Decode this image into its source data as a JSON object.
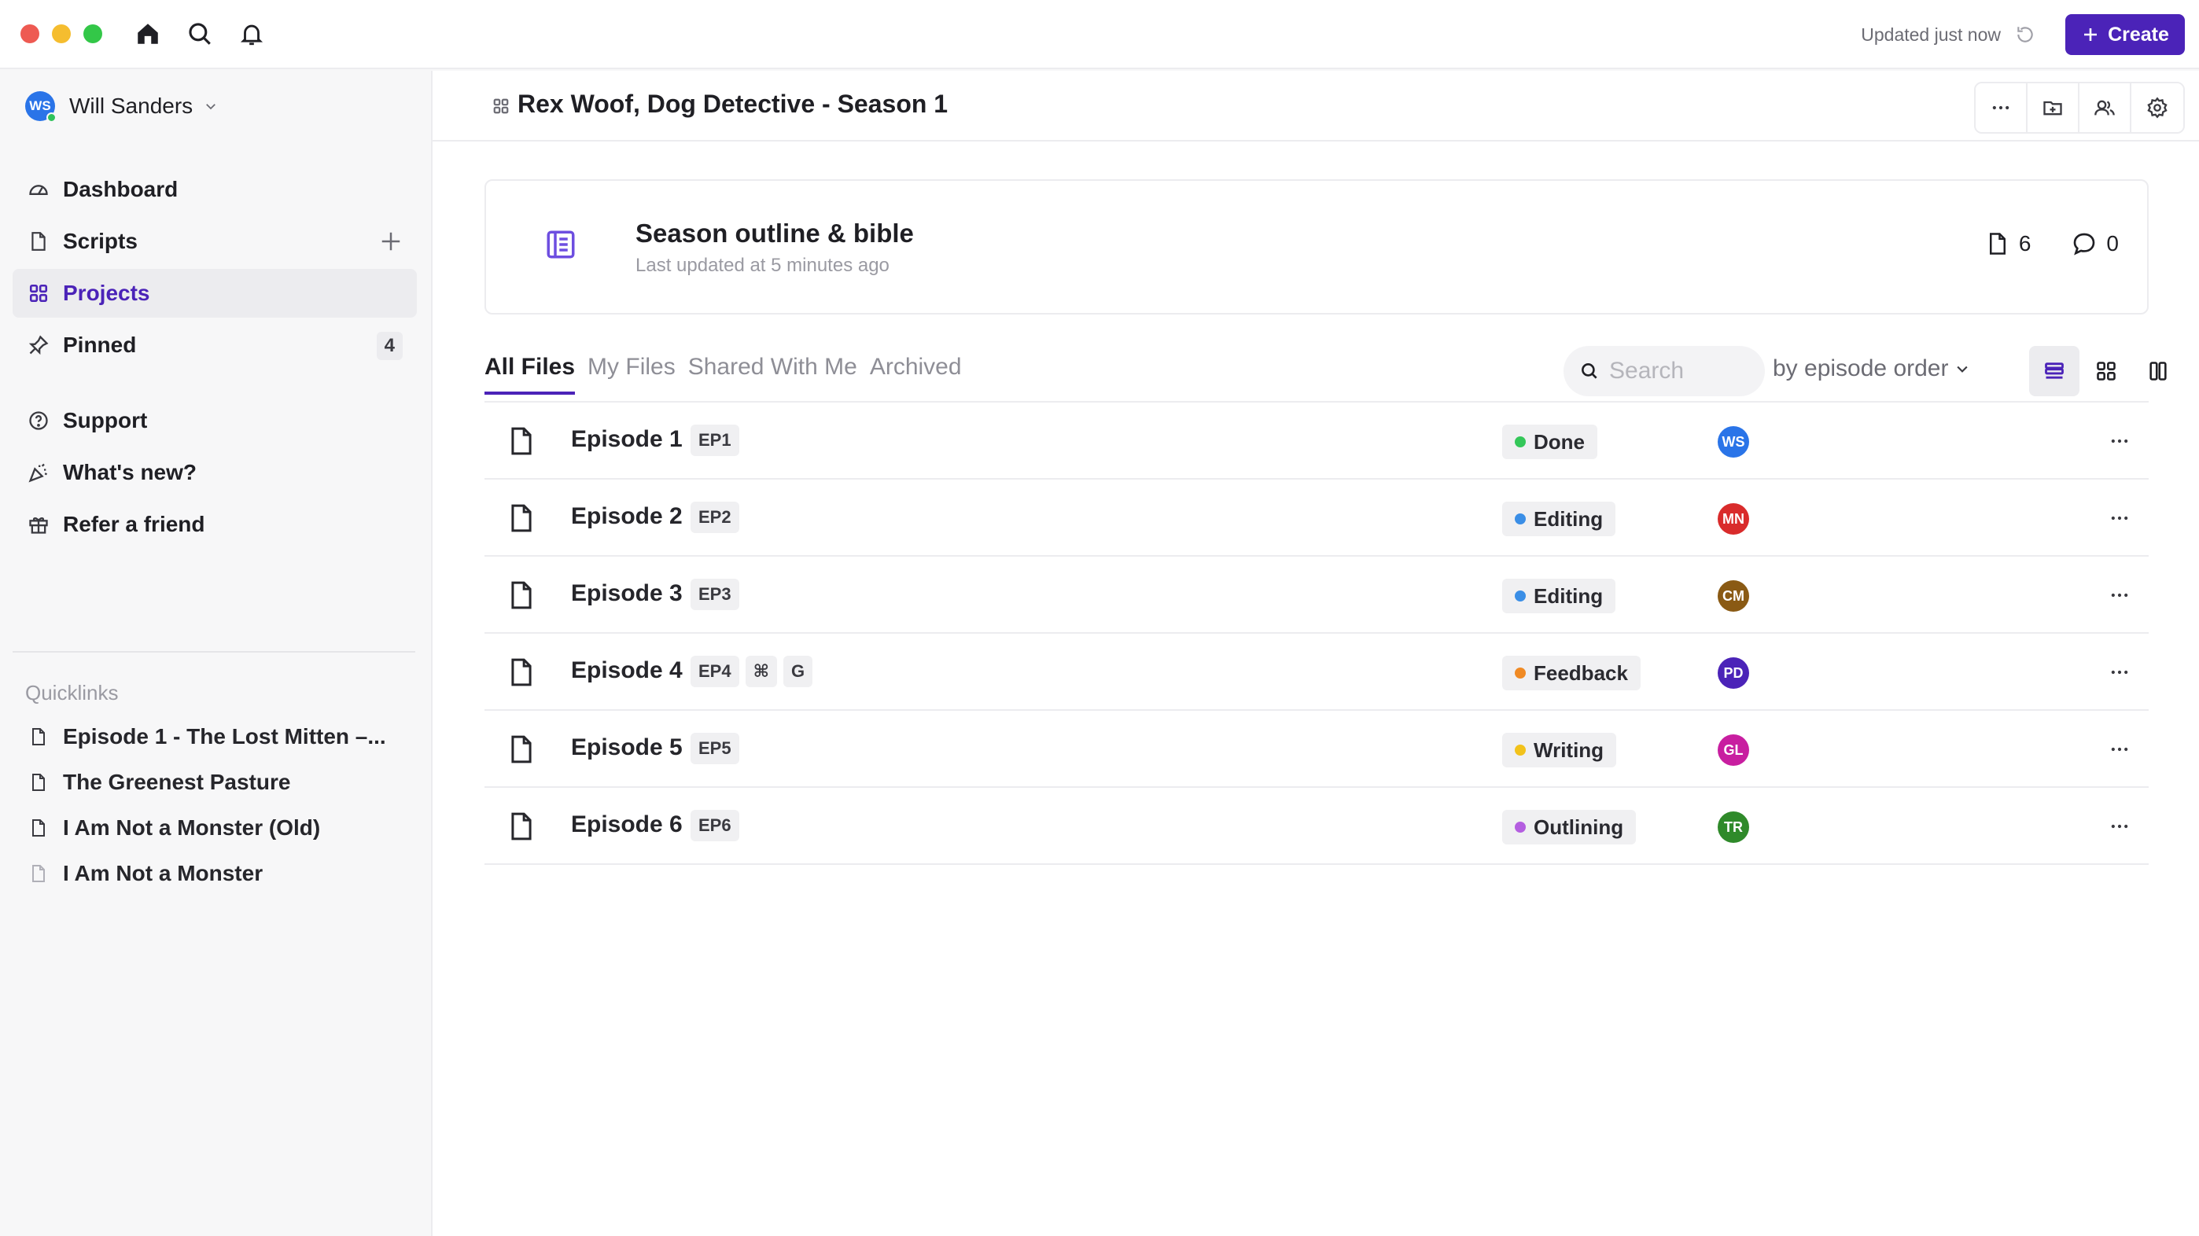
{
  "topbar": {
    "updated_text": "Updated just now",
    "create_label": "Create",
    "accent_color": "#4b23b8"
  },
  "sidebar": {
    "user": {
      "initials": "WS",
      "name": "Will Sanders"
    },
    "nav": [
      {
        "label": "Dashboard",
        "icon": "gauge-icon"
      },
      {
        "label": "Scripts",
        "icon": "document-icon"
      },
      {
        "label": "Projects",
        "icon": "grid-icon",
        "active": true
      },
      {
        "label": "Pinned",
        "icon": "pin-icon",
        "badge": "4"
      },
      {
        "label": "Support",
        "icon": "help-circle-icon"
      },
      {
        "label": "What's new?",
        "icon": "party-popper-icon"
      },
      {
        "label": "Refer a friend",
        "icon": "gift-icon"
      }
    ],
    "quicklinks_title": "Quicklinks",
    "quicklinks": [
      {
        "label": "Episode 1 - The Lost Mitten –..."
      },
      {
        "label": "The Greenest Pasture"
      },
      {
        "label": "I Am Not a Monster (Old)"
      },
      {
        "label": "I Am Not a Monster"
      }
    ]
  },
  "main": {
    "project_title": "Rex Woof, Dog Detective - Season 1",
    "outline": {
      "title": "Season outline & bible",
      "subtitle": "Last updated at 5 minutes ago",
      "doc_count": "6",
      "comment_count": "0"
    },
    "tabs": [
      {
        "label": "All Files",
        "active": true
      },
      {
        "label": "My Files"
      },
      {
        "label": "Shared With Me"
      },
      {
        "label": "Archived"
      }
    ],
    "search_placeholder": "Search",
    "sort_label": "by episode order",
    "files": [
      {
        "name": "Episode 1",
        "tags": [
          "EP1"
        ],
        "status": "Done",
        "status_color": "#34c759",
        "owner": "WS",
        "owner_color": "#2a74e8"
      },
      {
        "name": "Episode 2",
        "tags": [
          "EP2"
        ],
        "status": "Editing",
        "status_color": "#3a8ee6",
        "owner": "MN",
        "owner_color": "#d92b2b"
      },
      {
        "name": "Episode 3",
        "tags": [
          "EP3"
        ],
        "status": "Editing",
        "status_color": "#3a8ee6",
        "owner": "CM",
        "owner_color": "#8a5a14"
      },
      {
        "name": "Episode 4",
        "tags": [
          "EP4",
          "⌘",
          "G"
        ],
        "status": "Feedback",
        "status_color": "#f08a24",
        "owner": "PD",
        "owner_color": "#4b23b8"
      },
      {
        "name": "Episode 5",
        "tags": [
          "EP5"
        ],
        "status": "Writing",
        "status_color": "#f2c21b",
        "owner": "GL",
        "owner_color": "#c81ea0"
      },
      {
        "name": "Episode 6",
        "tags": [
          "EP6"
        ],
        "status": "Outlining",
        "status_color": "#b45ee0",
        "owner": "TR",
        "owner_color": "#2f8a2a"
      }
    ]
  }
}
